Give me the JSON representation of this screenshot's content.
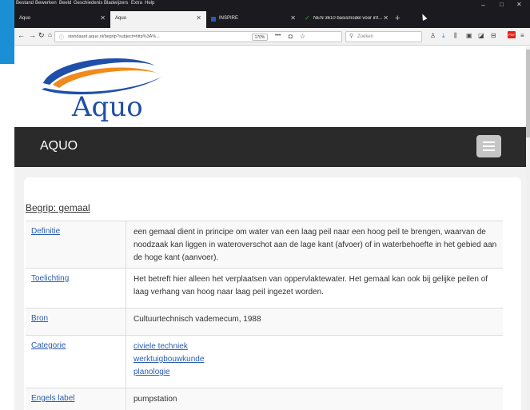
{
  "browser": {
    "menu": [
      "Bestand",
      "Bewerken",
      "Beeld",
      "Geschiedenis",
      "Bladwijzers",
      "Extra",
      "Help"
    ],
    "tabs": [
      {
        "title": "Aquo"
      },
      {
        "title": "Aquo"
      },
      {
        "title": "INSPIRE"
      },
      {
        "title": "NEN 3610 basismodel voor inf..."
      }
    ],
    "url": "standaard.aquo.nl/begrip?subject=http%3A%...",
    "zoom": "170%",
    "search_placeholder": "Zoeken"
  },
  "page": {
    "logo_text": "Aquo",
    "nav": {
      "brand": "AQUO"
    },
    "term_title": "Begrip: gemaal",
    "rows": [
      {
        "label": "Definitie",
        "value": "een gemaal dient in principe om water van een laag peil naar een hoog peil te brengen, waarvan de noodzaak kan liggen in wateroverschot aan de lage kant (afvoer) of in waterbehoefte in het gebied aan de hoge kant (aanvoer)."
      },
      {
        "label": "Toelichting",
        "value": "Het betreft hier alleen het verplaatsen van oppervlaktewater. Het gemaal kan ook bij gelijke peilen of laag verhang van hoog naar laag peil ingezet worden."
      },
      {
        "label": "Bron",
        "value": "Cultuurtechnisch vademecum, 1988"
      },
      {
        "label": "Categorie",
        "links": [
          "civiele techniek",
          "werktuigbouwkunde",
          "planologie"
        ]
      },
      {
        "label": "Engels label",
        "value": "pumpstation"
      }
    ]
  },
  "colors": {
    "brand_blue": "#1f4fa8",
    "logo_orange": "#f08a1c",
    "link": "#2a5db0",
    "navbar": "#2a2a2a"
  }
}
